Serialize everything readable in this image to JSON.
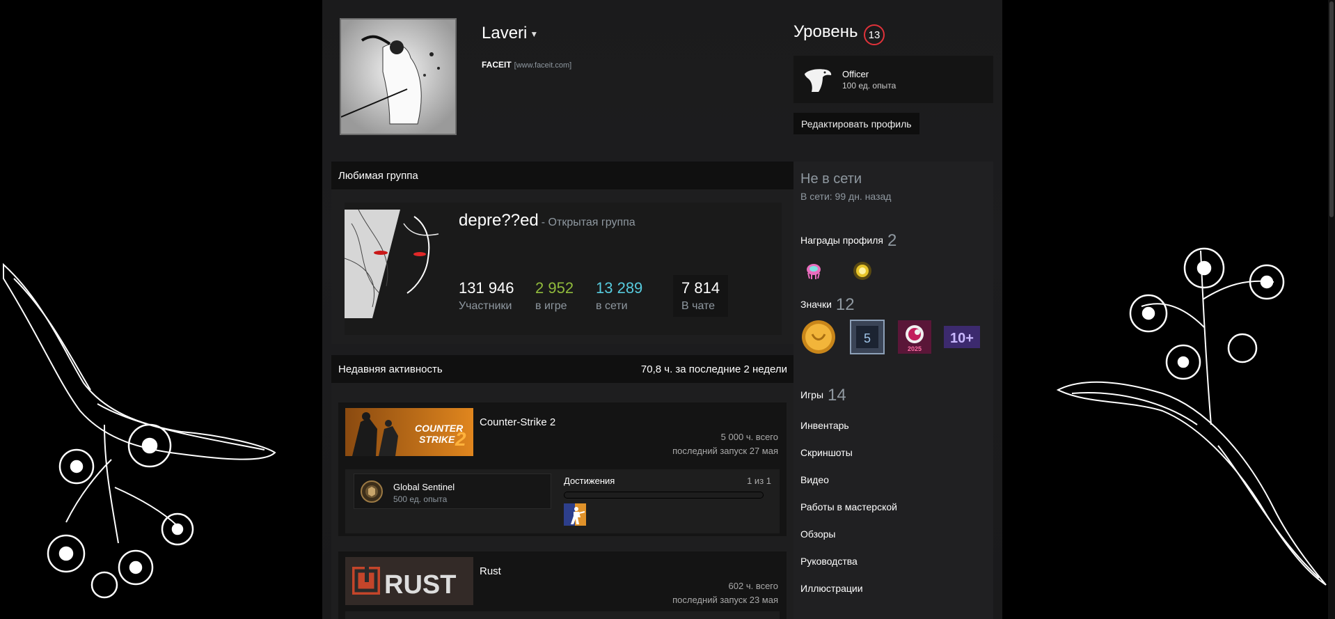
{
  "profile": {
    "persona_name": "Laveri",
    "faceit_label": "FACEIT",
    "faceit_url": "[www.faceit.com]",
    "level_label": "Уровень",
    "level": "13",
    "badge_name": "Officer",
    "badge_xp": "100 ед. опыта",
    "edit_profile": "Редактировать профиль"
  },
  "favorite_group": {
    "header": "Любимая группа",
    "name": "depre??ed",
    "type": "- Открытая группа",
    "stats": [
      {
        "value": "131 946",
        "label": "Участники",
        "color": "#ffffff"
      },
      {
        "value": "2 952",
        "label": "в игре",
        "color": "#90ba3c"
      },
      {
        "value": "13 289",
        "label": "в сети",
        "color": "#57cbde"
      },
      {
        "value": "7 814",
        "label": "В чате",
        "color": "#ffffff"
      }
    ]
  },
  "recent_activity": {
    "header": "Недавняя активность",
    "summary": "70,8 ч. за последние 2 недели",
    "games": [
      {
        "title": "Counter-Strike 2",
        "capsule_text_1": "COUNTER",
        "capsule_text_2": "STRIKE",
        "capsule_num": "2",
        "hours_total": "5 000 ч. всего",
        "last_played": "последний запуск 27 мая",
        "badge_name": "Global Sentinel",
        "badge_xp": "500 ед. опыта",
        "achievements_label": "Достижения",
        "achievements_count": "1 из 1",
        "achievements_progress": 1.0
      },
      {
        "title": "Rust",
        "capsule_text": "RUST",
        "hours_total": "602 ч. всего",
        "last_played": "последний запуск 23 мая"
      }
    ]
  },
  "sidebar": {
    "status": "Не в сети",
    "last_online": "В сети: 99 дн. назад",
    "awards_label": "Награды профиля",
    "awards_count": "2",
    "badges_label": "Значки",
    "badges_count": "12",
    "badge_years": "5",
    "badge_year_label": "2025",
    "badge_plus": "10+",
    "games_label": "Игры",
    "games_count": "14",
    "links": [
      "Инвентарь",
      "Скриншоты",
      "Видео",
      "Работы в мастерской",
      "Обзоры",
      "Руководства",
      "Иллюстрации"
    ]
  },
  "colors": {
    "accent_level": "#e0323a",
    "ingame": "#90ba3c",
    "online": "#57cbde"
  }
}
